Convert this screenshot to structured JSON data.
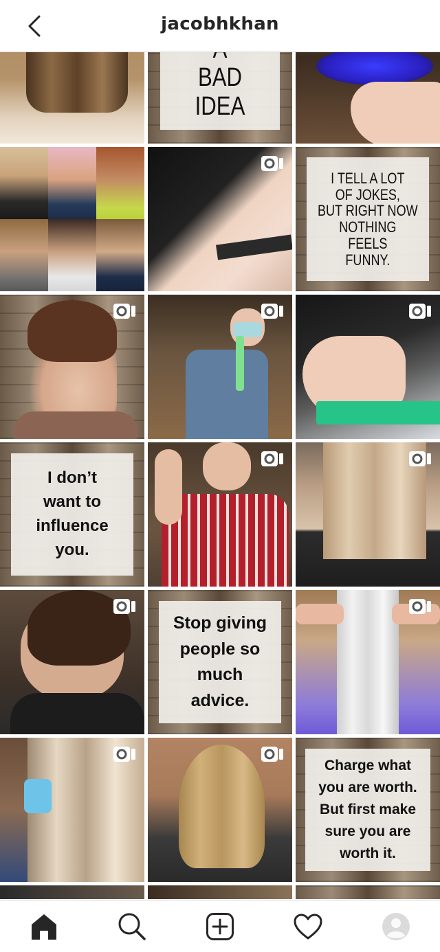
{
  "header": {
    "title": "jacobhkhan",
    "back_icon": "chevron-left-icon"
  },
  "posts": {
    "p2": {
      "lines": [
        "A",
        "BAD IDEA"
      ]
    },
    "p6": {
      "lines": [
        "I TELL A LOT",
        "OF JOKES,",
        "BUT RIGHT NOW",
        "NOTHING",
        "FEELS",
        "FUNNY."
      ]
    },
    "p10": {
      "lines": [
        "I don’t",
        "want to",
        "influence",
        "you."
      ]
    },
    "p14": {
      "lines": [
        "Stop giving",
        "people so",
        "much",
        "advice."
      ]
    },
    "p18": {
      "lines": [
        "Charge what",
        "you are worth.",
        "But first make",
        "sure you are",
        "worth it."
      ]
    },
    "video_icon": "video-camera-icon"
  },
  "tabbar": {
    "items": [
      "home-icon",
      "search-icon",
      "new-post-icon",
      "activity-heart-icon",
      "profile-avatar-icon"
    ]
  },
  "colors": {
    "border": "#dbdbdb",
    "icon": "#262626",
    "background": "#ffffff"
  }
}
